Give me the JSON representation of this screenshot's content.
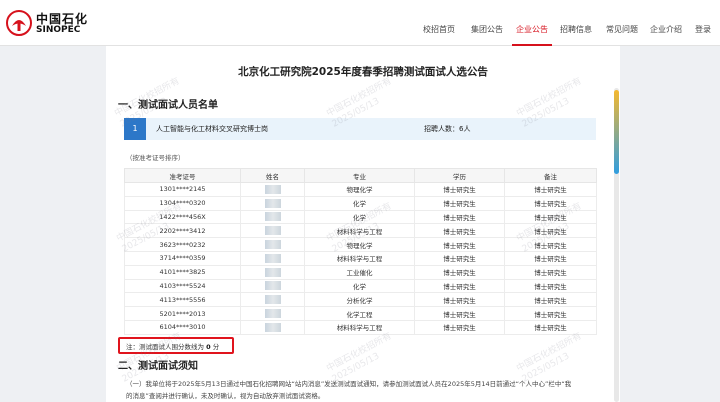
{
  "header": {
    "logo_cn": "中国石化",
    "logo_en": "SINOPEC",
    "nav": [
      "校招首页",
      "集团公告",
      "企业公告",
      "招聘信息",
      "常见问题",
      "企业介绍",
      "登录"
    ],
    "active_index": 2
  },
  "page": {
    "title": "北京化工研究院2025年度春季招聘测试面试人选公告",
    "section1": "一、测试面试人员名单",
    "position": {
      "num": "1",
      "name": "人工智能与化工材料交叉研究博士岗",
      "count": "招聘人数：6人"
    },
    "sort_note": "（按准考证号排序）",
    "columns": [
      "准考证号",
      "姓名",
      "专业",
      "学历",
      "备注"
    ],
    "rows": [
      {
        "id": "1301****2145",
        "major": "物理化学",
        "degree": "博士研究生",
        "remark": "博士研究生"
      },
      {
        "id": "1304****0320",
        "major": "化学",
        "degree": "博士研究生",
        "remark": "博士研究生"
      },
      {
        "id": "1422****456X",
        "major": "化学",
        "degree": "博士研究生",
        "remark": "博士研究生"
      },
      {
        "id": "2202****3412",
        "major": "材料科学与工程",
        "degree": "博士研究生",
        "remark": "博士研究生"
      },
      {
        "id": "3623****0232",
        "major": "物理化学",
        "degree": "博士研究生",
        "remark": "博士研究生"
      },
      {
        "id": "3714****0359",
        "major": "材料科学与工程",
        "degree": "博士研究生",
        "remark": "博士研究生"
      },
      {
        "id": "4101****3825",
        "major": "工业催化",
        "degree": "博士研究生",
        "remark": "博士研究生"
      },
      {
        "id": "4103****5524",
        "major": "化学",
        "degree": "博士研究生",
        "remark": "博士研究生"
      },
      {
        "id": "4113****5556",
        "major": "分析化学",
        "degree": "博士研究生",
        "remark": "博士研究生"
      },
      {
        "id": "5201****2013",
        "major": "化学工程",
        "degree": "博士研究生",
        "remark": "博士研究生"
      },
      {
        "id": "6104****3010",
        "major": "材料科学与工程",
        "degree": "博士研究生",
        "remark": "博士研究生"
      }
    ],
    "cutoff_prefix": "注：测试面试人围分数线为",
    "cutoff_value": "0",
    "cutoff_unit": "分",
    "section2": "二、测试面试须知",
    "para1": "（一）我单位将于2025年5月13日通过中国石化招聘网站“站内消息”发送测试面试通知，请参加测试面试人员在2025年5月14日前通过“个人中心”栏中“我",
    "para2": "的消息”查阅并进行确认，未及时确认，视为自动放弃测试面试资格。"
  },
  "watermark": {
    "line1": "中国石化校招所有",
    "line2": "2025/05/13"
  },
  "colors": {
    "brand_red": "#d6111c",
    "accent_blue": "#2c77c8",
    "highlight_box": "#e0141d"
  }
}
